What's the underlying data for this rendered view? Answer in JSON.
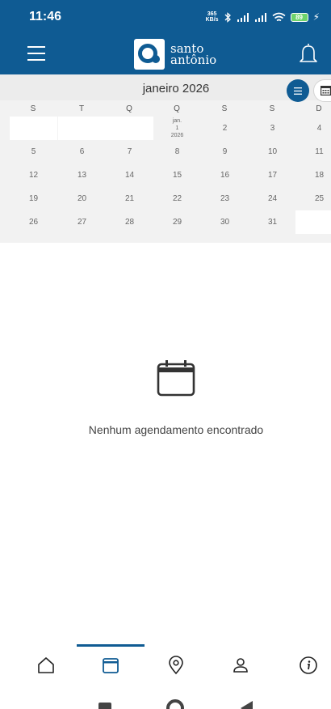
{
  "status_bar": {
    "time": "11:46",
    "speed_value": "365",
    "speed_unit": "KB/s",
    "battery": "89",
    "icons": [
      "bluetooth-icon",
      "signal-icon",
      "signal-icon",
      "wifi-icon",
      "battery-icon",
      "charging-icon"
    ]
  },
  "header": {
    "logo_line1": "santo",
    "logo_line2": "antônio",
    "background": "#0f5b93"
  },
  "calendar": {
    "month_title": "janeiro 2026",
    "weekdays": [
      "S",
      "T",
      "Q",
      "Q",
      "S",
      "S",
      "D"
    ],
    "today": {
      "line1": "jan.",
      "line2": "1",
      "line3": "2026"
    },
    "weeks": [
      [
        "",
        "",
        "",
        "",
        "2",
        "3",
        "4"
      ],
      [
        "5",
        "6",
        "7",
        "8",
        "9",
        "10",
        "11"
      ],
      [
        "12",
        "13",
        "14",
        "15",
        "16",
        "17",
        "18"
      ],
      [
        "19",
        "20",
        "21",
        "22",
        "23",
        "24",
        "25"
      ],
      [
        "26",
        "27",
        "28",
        "29",
        "30",
        "31",
        ""
      ]
    ]
  },
  "empty_state": {
    "message": "Nenhum agendamento encontrado",
    "icon": "calendar-icon"
  },
  "bottom_nav": {
    "items": [
      "home-icon",
      "calendar-icon",
      "location-icon",
      "profile-icon",
      "info-icon"
    ],
    "active_index": 1,
    "accent_color": "#0f5b93"
  }
}
